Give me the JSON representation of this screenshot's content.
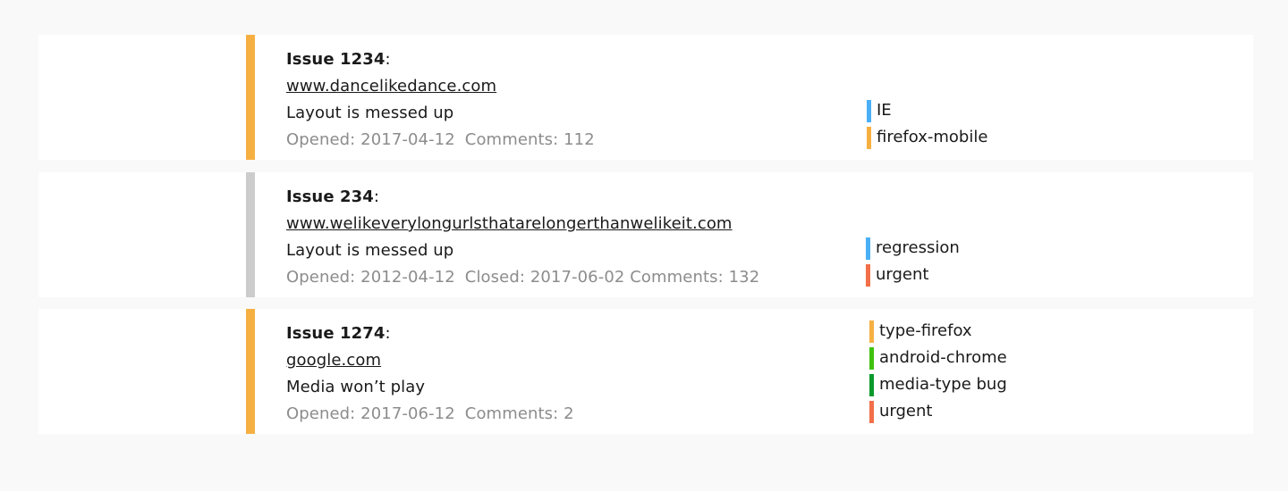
{
  "colors": {
    "page_background": "#f9f9f9",
    "card_background": "#ffffff",
    "open_bar": "#f6b042",
    "closed_bar": "#cccccc",
    "meta_text": "#8c8c8c"
  },
  "issues": [
    {
      "status": "open",
      "bar_color": "#f6b042",
      "title_prefix": "Issue 1234",
      "title_suffix": ":",
      "url": "www.dancelikedance.com",
      "description": "Layout is messed up",
      "meta": [
        "Opened: 2017-04-12",
        "Comments: 112"
      ],
      "labels": [
        {
          "text": "IE",
          "color": "#4ab0f5"
        },
        {
          "text": "firefox-mobile",
          "color": "#f6b042"
        }
      ]
    },
    {
      "status": "closed",
      "bar_color": "#cccccc",
      "title_prefix": "Issue 234",
      "title_suffix": ":",
      "url": "www.welikeverylongurlsthatarelongerthanwelikeit.com",
      "description": "Layout is messed up",
      "meta": [
        "Opened: 2012-04-12",
        "Closed: 2017-06-02 Comments: 132"
      ],
      "labels": [
        {
          "text": "regression",
          "color": "#4ab0f5"
        },
        {
          "text": "urgent",
          "color": "#f26f48"
        }
      ]
    },
    {
      "status": "open",
      "bar_color": "#f6b042",
      "title_prefix": "Issue 1274",
      "title_suffix": ":",
      "url": "google.com",
      "description": "Media won’t play",
      "meta": [
        "Opened: 2017-06-12",
        "Comments: 2"
      ],
      "labels": [
        {
          "text": "type-firefox",
          "color": "#f6b042"
        },
        {
          "text": "android-chrome",
          "color": "#3fc20e"
        },
        {
          "text": "media-type bug",
          "color": "#0a9a2b"
        },
        {
          "text": "urgent",
          "color": "#f26f48"
        }
      ]
    }
  ]
}
